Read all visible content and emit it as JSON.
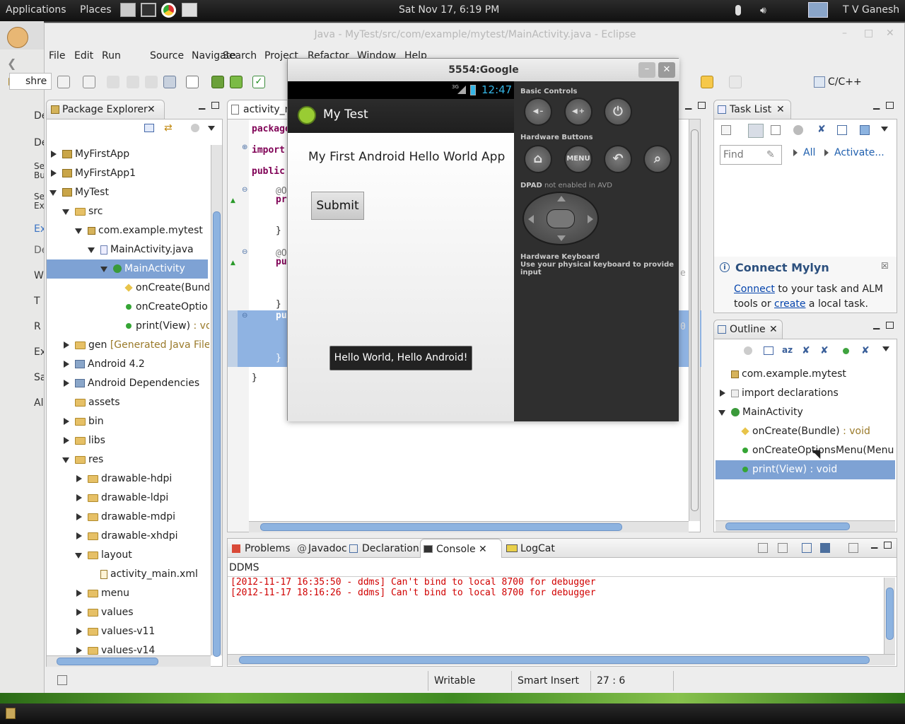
{
  "system_panel": {
    "applications": "Applications",
    "places": "Places",
    "datetime": "Sat Nov 17,  6:19 PM",
    "user": "T V Ganesh"
  },
  "eclipse": {
    "title": "Java - MyTest/src/com/example/mytest/MainActivity.java - Eclipse",
    "menu": [
      "File",
      "Edit",
      "Run",
      "Source",
      "Navigate",
      "Search",
      "Project",
      "Refactor",
      "Window",
      "Help"
    ],
    "perspective": "C/C++",
    "shre_label": "shre",
    "package_explorer": {
      "tab": "Package Explorer",
      "items": [
        {
          "label": "MyFirstApp"
        },
        {
          "label": "MyFirstApp1"
        },
        {
          "label": "MyTest"
        },
        {
          "label": "src"
        },
        {
          "label": "com.example.mytest"
        },
        {
          "label": "MainActivity.java"
        },
        {
          "label": "MainActivity"
        },
        {
          "label": "onCreate(Bund"
        },
        {
          "label": "onCreateOptio"
        },
        {
          "label": "print(View)",
          "suffix": " : vo"
        },
        {
          "label": "gen",
          "suffix": " [Generated Java Files]"
        },
        {
          "label": "Android 4.2"
        },
        {
          "label": "Android Dependencies"
        },
        {
          "label": "assets"
        },
        {
          "label": "bin"
        },
        {
          "label": "libs"
        },
        {
          "label": "res"
        },
        {
          "label": "drawable-hdpi"
        },
        {
          "label": "drawable-ldpi"
        },
        {
          "label": "drawable-mdpi"
        },
        {
          "label": "drawable-xhdpi"
        },
        {
          "label": "layout"
        },
        {
          "label": "activity_main.xml"
        },
        {
          "label": "menu"
        },
        {
          "label": "values"
        },
        {
          "label": "values-v11"
        },
        {
          "label": "values-v14"
        }
      ]
    },
    "editor": {
      "tab": "activity_m",
      "lines": {
        "l1": "package",
        "l2": "import",
        "l3": "public",
        "l4": "@Ov",
        "l5": "pro",
        "l6": "}",
        "l7": "@Ov",
        "l8": "pub",
        "l9": "}",
        "l10": "pub",
        "l11": "}",
        "l12": "}",
        "right_e": "e",
        "right_0": "0"
      }
    },
    "task_list": {
      "tab": "Task List",
      "find_placeholder": "Find",
      "all": "All",
      "activate": "Activate...",
      "mylyn_title": "Connect Mylyn",
      "mylyn_connect": "Connect",
      "mylyn_text1": " to your task and ALM",
      "mylyn_text2": "tools or ",
      "mylyn_create": "create",
      "mylyn_text3": " a local task."
    },
    "outline": {
      "tab": "Outline",
      "items": [
        {
          "label": "com.example.mytest"
        },
        {
          "label": "import declarations"
        },
        {
          "label": "MainActivity"
        },
        {
          "label": "onCreate(Bundle)",
          "suffix": " : void"
        },
        {
          "label": "onCreateOptionsMenu(Menu"
        },
        {
          "label": "print(View) : void"
        }
      ]
    },
    "bottom_tabs": [
      "Problems",
      "Javadoc",
      "Declaration",
      "Console",
      "LogCat"
    ],
    "console": {
      "title": "DDMS",
      "lines": [
        "[2012-11-17 16:35:50 - ddms] Can't bind to local 8700 for debugger",
        "[2012-11-17 18:16:26 - ddms] Can't bind to local 8700 for debugger"
      ]
    },
    "status": {
      "writable": "Writable",
      "insert": "Smart Insert",
      "position": "27 : 6"
    }
  },
  "left_desktop": [
    "De",
    "De",
    "Se Bu",
    "Se Ex",
    "Ex",
    "De",
    "W",
    "T",
    "R",
    "Ex",
    "Sa",
    "Al"
  ],
  "emulator": {
    "title": "5554:Google",
    "status_time": "12:47",
    "signal": "3G",
    "app_title": "My Test",
    "hello_text": "My First Android Hello World App",
    "submit": "Submit",
    "toast": "Hello World, Hello Android!",
    "basic_controls": "Basic Controls",
    "hardware_buttons": "Hardware Buttons",
    "menu_btn": "MENU",
    "dpad": "DPAD",
    "dpad_note": " not enabled in AVD",
    "hw_keyboard": "Hardware Keyboard",
    "hw_keyboard_note": "Use your physical keyboard to provide input"
  }
}
